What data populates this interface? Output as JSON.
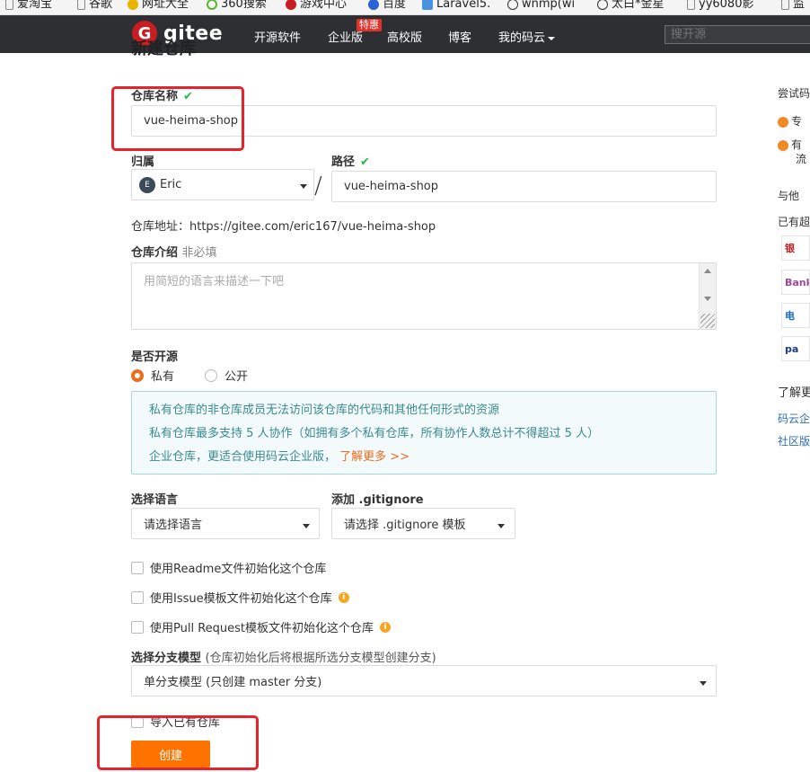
{
  "bookmarks": [
    "爱淘宝",
    "谷歌",
    "网址大全",
    "360搜索",
    "游戏中心",
    "百度",
    "Laravel5.",
    "wnmp(wi",
    "太白*金星",
    "yy6080影",
    "监"
  ],
  "nav": {
    "logo": "gitee",
    "links": [
      "开源软件",
      "企业版",
      "高校版",
      "博客",
      "我的码云"
    ],
    "badge": "特惠",
    "search_placeholder": "搜开源"
  },
  "form": {
    "page_title": "新建仓库",
    "repo_name_label": "仓库名称",
    "repo_name_value": "vue-heima-shop",
    "owner_label": "归属",
    "owner_value": "Eric",
    "owner_avatar": "E",
    "path_label": "路径",
    "path_value": "vue-heima-shop",
    "repo_url": "仓库地址：https://gitee.com/eric167/vue-heima-shop",
    "intro_label": "仓库介绍",
    "intro_optional": "非必填",
    "intro_placeholder": "用简短的语言来描述一下吧",
    "open_label": "是否开源",
    "radio_private": "私有",
    "radio_public": "公开",
    "info_line1": "私有仓库的非仓库成员无法访问该仓库的代码和其他任何形式的资源",
    "info_line2": "私有仓库最多支持 5 人协作（如拥有多个私有仓库，所有协作人数总计不得超过 5 人）",
    "info_line3": "企业仓库，更适合使用码云企业版，",
    "info_link": "了解更多 >>",
    "lang_label": "选择语言",
    "lang_value": "请选择语言",
    "gitignore_label": "添加 .gitignore",
    "gitignore_value": "请选择 .gitignore 模板",
    "cb_readme": "使用Readme文件初始化这个仓库",
    "cb_issue": "使用Issue模板文件初始化这个仓库",
    "cb_pr": "使用Pull Request模板文件初始化这个仓库",
    "branch_label": "选择分支模型",
    "branch_hint": "(仓库初始化后将根据所选分支模型创建分支)",
    "branch_value": "单分支模型 (只创建 master 分支)",
    "import_label": "导入已有仓库",
    "create_button": "创建"
  },
  "sidebar": {
    "try": "尝试码",
    "item1": "专",
    "item2": "有",
    "item2b": "流",
    "with": "与他",
    "already": "已有超",
    "partners": [
      "银",
      "Bank",
      "电",
      "pa"
    ],
    "learn": "了解更",
    "link1": "码云企",
    "link2": "社区版"
  },
  "colors": {
    "accent": "#fe7300",
    "nav_bg": "#2d2f33",
    "annotation": "#e8222a",
    "check": "#21ba45"
  }
}
